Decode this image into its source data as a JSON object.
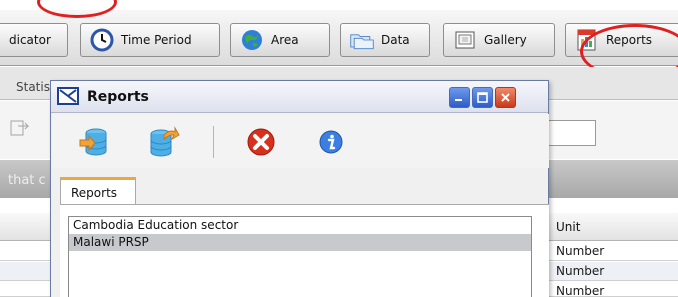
{
  "toolbar": {
    "tabs": [
      {
        "label": "dicator",
        "icon": "indicator-icon"
      },
      {
        "label": "Time Period",
        "icon": "clock-icon"
      },
      {
        "label": "Area",
        "icon": "globe-icon"
      },
      {
        "label": "Data",
        "icon": "folders-icon"
      },
      {
        "label": "Gallery",
        "icon": "gallery-icon"
      },
      {
        "label": "Reports",
        "icon": "reports-icon"
      }
    ]
  },
  "background": {
    "subtab_label": "Statis",
    "filter_text": "that c",
    "grid": {
      "unit_header": "Unit",
      "rows": [
        "Number",
        "Number",
        "Number"
      ]
    }
  },
  "dialog": {
    "title": "Reports",
    "tools": [
      "database-import-icon",
      "database-export-icon",
      "delete-icon",
      "info-icon"
    ],
    "tab_label": "Reports",
    "reports": [
      {
        "name": "Cambodia Education sector",
        "selected": false
      },
      {
        "name": "Malawi PRSP",
        "selected": true
      }
    ]
  },
  "colors": {
    "annotation": "#e02020",
    "selection": "#c7c9cc",
    "tab_accent": "#f0a640"
  }
}
